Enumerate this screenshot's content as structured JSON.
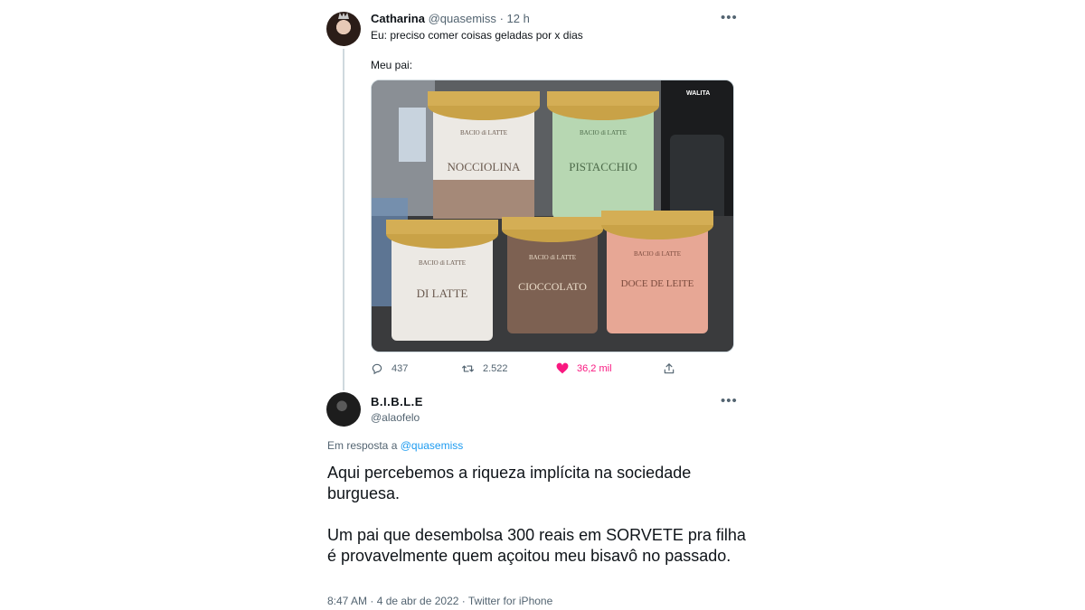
{
  "tweet1": {
    "name": "Catharina",
    "handle": "@quasemiss",
    "separator": "·",
    "time": "12 h",
    "text_line1": "Eu: preciso comer coisas geladas por x dias",
    "text_line2": "Meu pai:",
    "media": {
      "pints": [
        {
          "brand": "BACIO di LATTE",
          "flavor": "NOCCIOLINA",
          "color": "#ece9e4"
        },
        {
          "brand": "BACIO di LATTE",
          "flavor": "PISTACCHIO",
          "color": "#b7d7b2"
        },
        {
          "brand": "BACIO di LATTE",
          "flavor": "DI LATTE",
          "color": "#ece9e4"
        },
        {
          "brand": "BACIO di LATTE",
          "flavor": "CIOCCOLATO",
          "color": "#7d6152"
        },
        {
          "brand": "BACIO di LATTE",
          "flavor": "DOCE DE LEITE",
          "color": "#e7a795"
        }
      ],
      "kettle_label": "WALITA"
    },
    "actions": {
      "reply_count": "437",
      "retweet_count": "2.522",
      "like_count": "36,2 mil"
    },
    "like_color": "#f91880"
  },
  "tweet2": {
    "name": "B.I.B.L.E",
    "handle": "@alaofelo",
    "reply_prefix": "Em resposta a",
    "reply_handle": "@quasemiss",
    "paragraph1": "Aqui percebemos a riqueza implícita na sociedade burguesa.",
    "paragraph2": "Um pai que desembolsa 300 reais em SORVETE pra filha é provavelmente quem açoitou meu bisavô no passado.",
    "meta": "8:47 AM · 4 de abr de 2022 · Twitter for iPhone"
  },
  "colors": {
    "link": "#1d9bf0",
    "muted": "#536471",
    "text": "#0f1419"
  }
}
